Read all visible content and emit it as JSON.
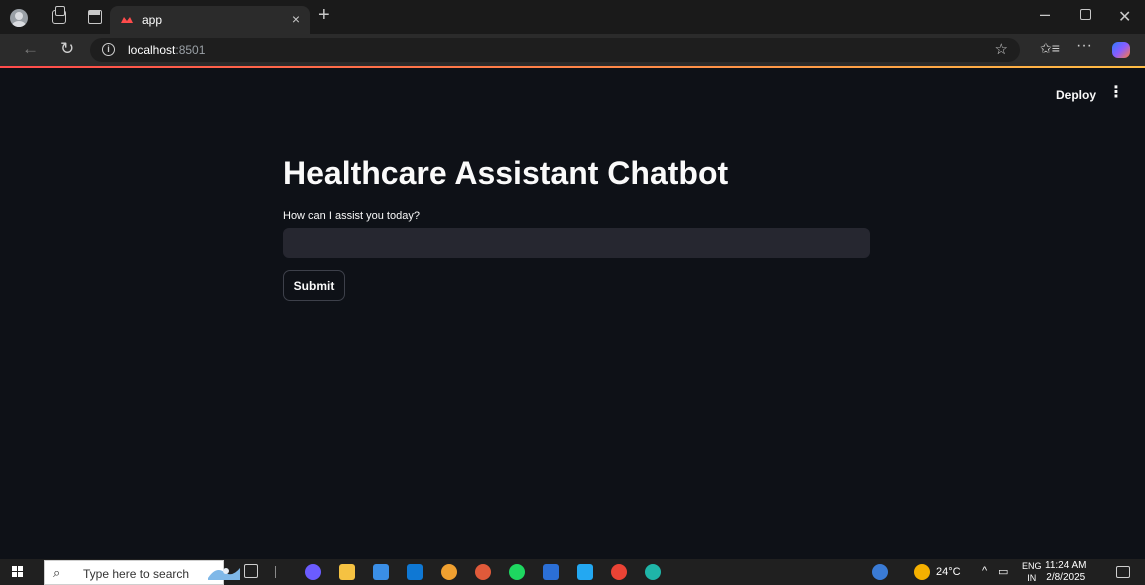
{
  "browser": {
    "tab": {
      "title": "app",
      "close_glyph": "×"
    },
    "new_tab_glyph": "+",
    "url_host": "localhost",
    "url_port": ":8501",
    "window_controls": {
      "minimize": "–",
      "close": "✕"
    },
    "icons": {
      "back": "←",
      "reload": "↻",
      "favorite": "☆",
      "favorites": "✩≡",
      "more": "···"
    }
  },
  "app": {
    "deploy_label": "Deploy",
    "menu_glyph": "⋮",
    "title": "Healthcare Assistant Chatbot",
    "input_label": "How can I assist you today?",
    "input_value": "",
    "submit_label": "Submit",
    "colors": {
      "background": "#0e1117",
      "input_bg": "#262730",
      "accent_start": "#ff4b4b",
      "accent_end": "#ffbd45"
    }
  },
  "taskbar": {
    "search_placeholder": "Type here to search",
    "weather": "24°C",
    "language_top": "ENG",
    "language_bottom": "IN",
    "time": "11:24 AM",
    "date": "2/8/2025",
    "pinned": [
      {
        "name": "copilot-icon",
        "color": "#6b5cff"
      },
      {
        "name": "file-explorer-icon",
        "color": "#f5c242"
      },
      {
        "name": "microsoft-store-icon",
        "color": "#3a8ee6"
      },
      {
        "name": "outlook-icon",
        "color": "#0f78d4"
      },
      {
        "name": "chrome-icon",
        "color": "#f0a030"
      },
      {
        "name": "chrome-profile-icon",
        "color": "#e05a3a"
      },
      {
        "name": "spotify-icon",
        "color": "#1ed760"
      },
      {
        "name": "word-icon",
        "color": "#2b6fd6"
      },
      {
        "name": "vscode-icon",
        "color": "#23a8f2"
      },
      {
        "name": "chrome-alt-icon",
        "color": "#ea4335"
      },
      {
        "name": "edge-icon",
        "color": "#1fb5a8"
      }
    ]
  }
}
